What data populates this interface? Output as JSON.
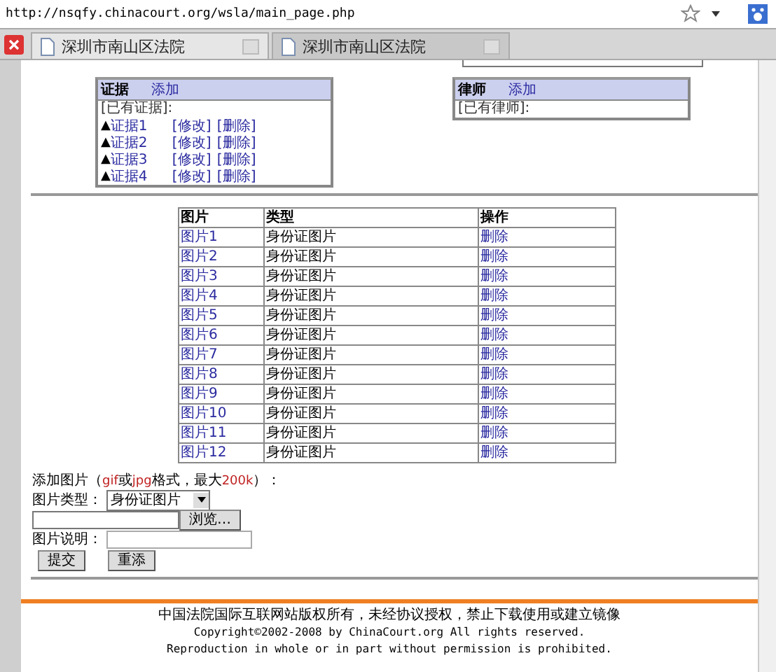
{
  "address_bar": {
    "url": "http://nsqfy.chinacourt.org/wsla/main_page.php"
  },
  "tabs": [
    {
      "title": "深圳市南山区法院",
      "selected": true
    },
    {
      "title": "深圳市南山区法院",
      "selected": false
    }
  ],
  "evidence_panel": {
    "title": "证据",
    "add_link": "添加",
    "existing_label": "[已有证据]:",
    "items": [
      {
        "name": "证据1",
        "edit": "[修改]",
        "delete": "[删除]"
      },
      {
        "name": "证据2",
        "edit": "[修改]",
        "delete": "[删除]"
      },
      {
        "name": "证据3",
        "edit": "[修改]",
        "delete": "[删除]"
      },
      {
        "name": "证据4",
        "edit": "[修改]",
        "delete": "[删除]"
      }
    ],
    "marker": "▲"
  },
  "lawyer_panel": {
    "title": "律师",
    "add_link": "添加",
    "existing_label": "[已有律师]:"
  },
  "table": {
    "columns": [
      "图片",
      "类型",
      "操作"
    ],
    "rows": [
      [
        "图片1",
        "身份证图片",
        "删除"
      ],
      [
        "图片2",
        "身份证图片",
        "删除"
      ],
      [
        "图片3",
        "身份证图片",
        "删除"
      ],
      [
        "图片4",
        "身份证图片",
        "删除"
      ],
      [
        "图片5",
        "身份证图片",
        "删除"
      ],
      [
        "图片6",
        "身份证图片",
        "删除"
      ],
      [
        "图片7",
        "身份证图片",
        "删除"
      ],
      [
        "图片8",
        "身份证图片",
        "删除"
      ],
      [
        "图片9",
        "身份证图片",
        "删除"
      ],
      [
        "图片10",
        "身份证图片",
        "删除"
      ],
      [
        "图片11",
        "身份证图片",
        "删除"
      ],
      [
        "图片12",
        "身份证图片",
        "删除"
      ]
    ]
  },
  "upload_form": {
    "heading": [
      {
        "text": "添加图片（",
        "highlight": false
      },
      {
        "text": "gif",
        "highlight": true
      },
      {
        "text": "或",
        "highlight": false
      },
      {
        "text": "jpg",
        "highlight": true
      },
      {
        "text": "格式，最大",
        "highlight": false
      },
      {
        "text": "200k",
        "highlight": true
      },
      {
        "text": "）：",
        "highlight": false
      }
    ],
    "type_label": "图片类型：",
    "type_value": "身份证图片",
    "browse_button": "浏览…",
    "description_label": "图片说明：",
    "submit_button": "提交",
    "reset_button": "重添"
  },
  "footer": [
    "中国法院国际互联网站版权所有，未经协议授权，禁止下载使用或建立镜像",
    "Copyright©2002-2008 by ChinaCourt.org All rights reserved.",
    "Reproduction in whole or in part without permission is prohibited."
  ]
}
